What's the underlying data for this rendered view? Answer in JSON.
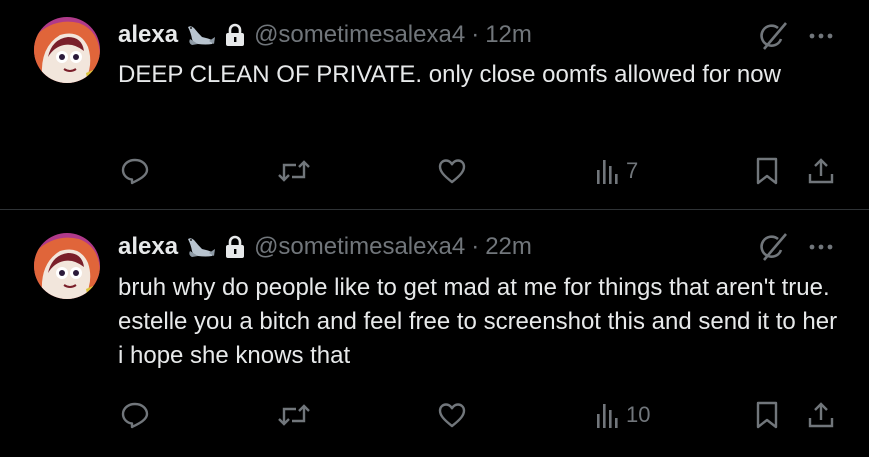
{
  "tweets": [
    {
      "name": "alexa",
      "handle": "@sometimesalexa4",
      "separator": "·",
      "time": "12m",
      "text": "DEEP CLEAN OF PRIVATE. only close oomfs allowed for now",
      "views": "7"
    },
    {
      "name": "alexa",
      "handle": "@sometimesalexa4",
      "separator": "·",
      "time": "22m",
      "text": "bruh why do people like to get mad at me for things that aren't true. estelle you a bitch and feel free to screenshot this and send it to her i hope she knows that",
      "views": "10"
    }
  ],
  "icons": {
    "seal": "seal-emoji-icon",
    "lock": "lock-icon",
    "grok": "grok-icon",
    "more": "more-icon",
    "reply": "reply-icon",
    "retweet": "retweet-icon",
    "like": "like-icon",
    "views": "views-icon",
    "bookmark": "bookmark-icon",
    "share": "share-icon"
  },
  "colors": {
    "background": "#000000",
    "text": "#e7e9ea",
    "secondary": "#71767b",
    "divider": "#2f3336"
  }
}
